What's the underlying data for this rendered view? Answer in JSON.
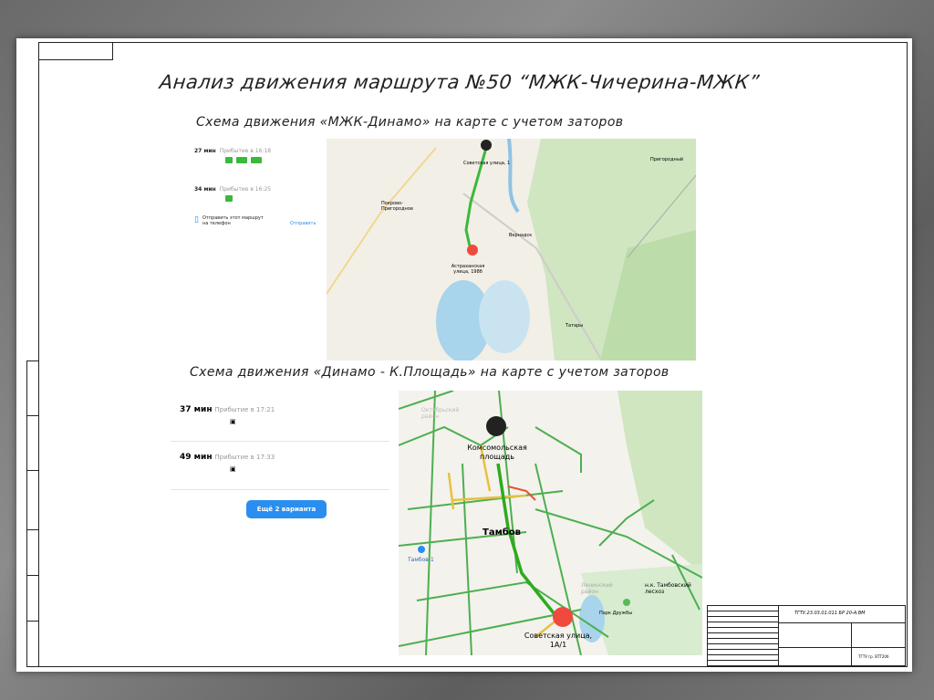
{
  "title": "Анализ движения маршрута №50 “МЖК-Чичерина-МЖК”",
  "section1": {
    "heading": "Схема движения «МЖК-Динамо» на карте с учетом заторов",
    "routes": [
      {
        "duration": "27 мин",
        "arrival": "Прибытие в 16:18"
      },
      {
        "duration": "34 мин",
        "arrival": "Прибытие в 16:25"
      }
    ],
    "send_text": "Отправить этот маршрут на телефон",
    "send_button": "Отправить",
    "map": {
      "start_label": "Советская улица, 1",
      "end_label": "Астраханская улица, 198б",
      "place_labels": [
        "Покрово-Пригородное",
        "Вернадск",
        "Пригородный",
        "Татары"
      ]
    }
  },
  "section2": {
    "heading": "Схема движения «Динамо - К.Площадь» на карте с учетом заторов",
    "routes": [
      {
        "duration": "37 мин",
        "arrival": "Прибытие в 17:21"
      },
      {
        "duration": "49 мин",
        "arrival": "Прибытие в 17:33"
      }
    ],
    "more_button": "Ещё 2 варианта",
    "map": {
      "start_label": "Комсомольская площадь",
      "end_label": "Советская улица, 1А/1",
      "city_label": "Тамбов",
      "station_label": "Тамбов-1",
      "district_label": "Ленинский район",
      "forest_label": "н.к. Тамбовский лесхоз",
      "park_label": "Парк Дружбы",
      "district2_label": "Октябрьский район"
    }
  },
  "title_block": {
    "code": "ТГТУ.23.03.01.011 БР 20-А.ВМ",
    "org": "ТГТУ гр. ВТТ20б"
  },
  "colors": {
    "route_green": "#3bb93b",
    "marker_red": "#f04a3e",
    "button_blue": "#2a8ef0"
  }
}
